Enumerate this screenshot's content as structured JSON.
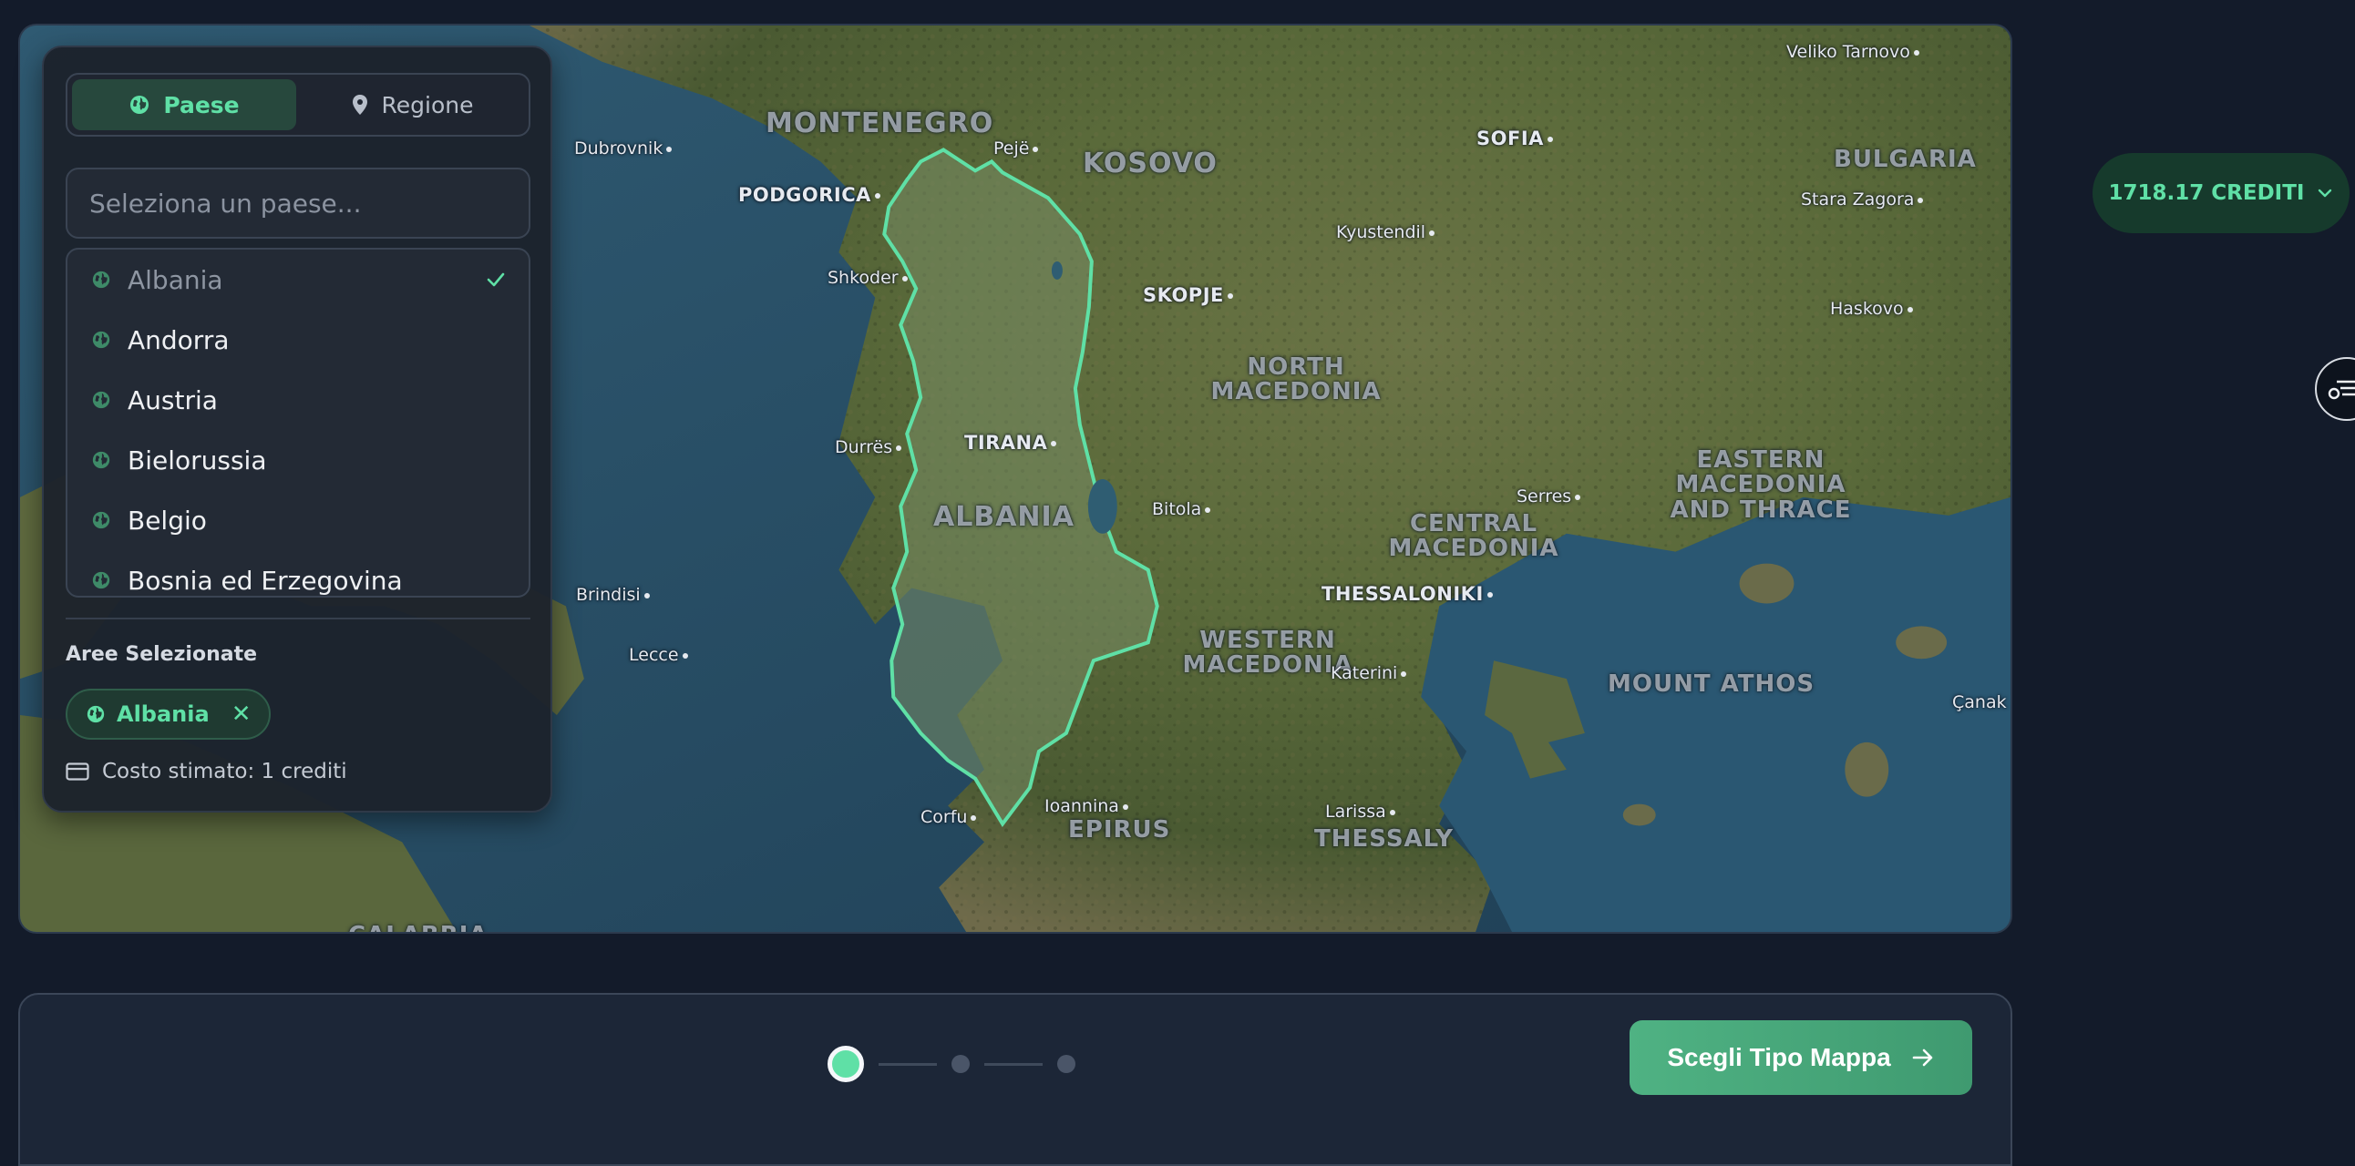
{
  "panel": {
    "toggle": {
      "country_label": "Paese",
      "region_label": "Regione"
    },
    "search": {
      "placeholder": "Seleziona un paese..."
    },
    "countries": [
      {
        "label": "Albania",
        "selected": true
      },
      {
        "label": "Andorra",
        "selected": false
      },
      {
        "label": "Austria",
        "selected": false
      },
      {
        "label": "Bielorussia",
        "selected": false
      },
      {
        "label": "Belgio",
        "selected": false
      },
      {
        "label": "Bosnia ed Erzegovina",
        "selected": false
      }
    ],
    "selected_title": "Aree Selezionate",
    "selected_chip": "Albania",
    "cost_text": "Costo stimato: 1 crediti"
  },
  "credits": {
    "label": "1718.17 CREDITI"
  },
  "footer": {
    "next_label": "Scegli Tipo Mappa",
    "current_step": 1,
    "total_steps": 3
  },
  "map": {
    "regions": [
      "MONTENEGRO",
      "KOSOVO",
      "NORTH MACEDONIA",
      "ALBANIA",
      "BULGARIA",
      "EASTERN MACEDONIA AND THRACE",
      "CENTRAL MACEDONIA",
      "WESTERN MACEDONIA",
      "MOUNT ATHOS",
      "EPIRUS",
      "THESSALY",
      "CALABRIA"
    ],
    "capitals": [
      "PODGORICA",
      "SKOPJE",
      "SOFIA",
      "TIRANA",
      "THESSALONIKI"
    ],
    "cities": [
      "Dubrovnik",
      "Pejë",
      "Shkoder",
      "Durrës",
      "Brindisi",
      "Lecce",
      "Bitola",
      "Kyustendil",
      "Serres",
      "Katerini",
      "Larissa",
      "Ioannina",
      "Corfu",
      "Veliko Tarnovo",
      "Stara Zagora",
      "Haskovo",
      "Çanak"
    ],
    "colors": {
      "highlight": "#5fe0a6",
      "sea": "#284c63",
      "land": "#5a6a3f"
    }
  }
}
